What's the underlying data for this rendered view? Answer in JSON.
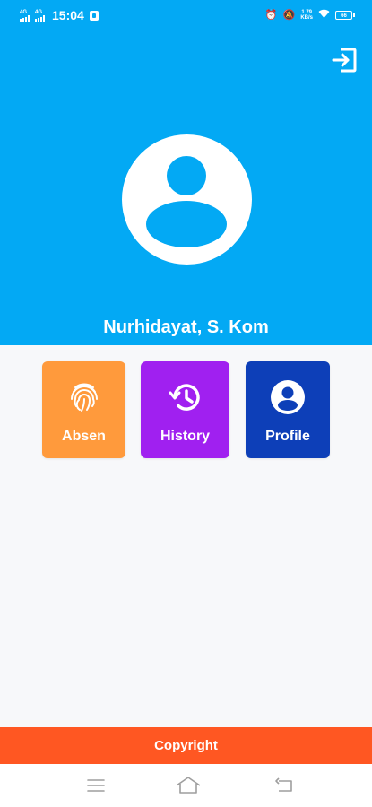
{
  "status_bar": {
    "network_1": "4G",
    "network_2": "4G",
    "time": "15:04",
    "speed_value": "1.79",
    "speed_unit": "KB/s",
    "battery": "66"
  },
  "header": {
    "user_name": "Nurhidayat, S. Kom",
    "logout_icon": "logout-icon",
    "avatar_icon": "user-avatar-icon"
  },
  "menu": {
    "items": [
      {
        "label": "Absen",
        "icon": "fingerprint-icon",
        "color": "#FF9A3C"
      },
      {
        "label": "History",
        "icon": "history-icon",
        "color": "#A020F0"
      },
      {
        "label": "Profile",
        "icon": "account-circle-icon",
        "color": "#0D3FB8"
      }
    ]
  },
  "footer": {
    "label": "Copyright"
  },
  "colors": {
    "header": "#03A9F4",
    "footer": "#FF5722",
    "background": "#F7F8FA"
  }
}
